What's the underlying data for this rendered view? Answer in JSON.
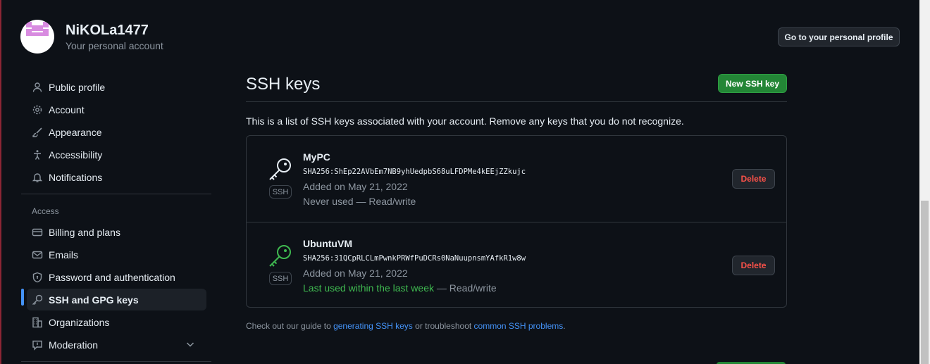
{
  "user": {
    "name": "NiKOLa1477",
    "subtitle": "Your personal account",
    "profile_button": "Go to your personal profile"
  },
  "sidebar": {
    "items": [
      {
        "label": "Public profile",
        "icon": "person-icon"
      },
      {
        "label": "Account",
        "icon": "gear-icon"
      },
      {
        "label": "Appearance",
        "icon": "paintbrush-icon"
      },
      {
        "label": "Accessibility",
        "icon": "accessibility-icon"
      },
      {
        "label": "Notifications",
        "icon": "bell-icon"
      }
    ],
    "access_label": "Access",
    "access_items": [
      {
        "label": "Billing and plans",
        "icon": "credit-card-icon"
      },
      {
        "label": "Emails",
        "icon": "mail-icon"
      },
      {
        "label": "Password and authentication",
        "icon": "shield-lock-icon"
      },
      {
        "label": "SSH and GPG keys",
        "icon": "key-icon",
        "active": true
      },
      {
        "label": "Organizations",
        "icon": "organization-icon"
      },
      {
        "label": "Moderation",
        "icon": "report-icon"
      }
    ]
  },
  "main": {
    "title": "SSH keys",
    "new_button": "New SSH key",
    "intro": "This is a list of SSH keys associated with your account. Remove any keys that you do not recognize.",
    "keys": [
      {
        "name": "MyPC",
        "fingerprint": "SHA256:ShEp22AVbEm7NB9yhUedpbS68uLFDPMe4kEEjZZkujc",
        "added": "Added on May 21, 2022",
        "usage_plain": "Never used — Read/write",
        "badge": "SSH",
        "icon_color": "#e6edf3",
        "delete": "Delete"
      },
      {
        "name": "UbuntuVM",
        "fingerprint": "SHA256:31QCpRLCLmPwnkPRWfPuDCRs0NaNuupnsmYAfkR1w8w",
        "added": "Added on May 21, 2022",
        "usage_green": "Last used within the last week",
        "usage_rest": " — Read/write",
        "badge": "SSH",
        "icon_color": "#3fb950",
        "delete": "Delete"
      }
    ],
    "footer": {
      "prefix": "Check out our guide to ",
      "link1": "generating SSH keys",
      "middle": " or troubleshoot ",
      "link2": "common SSH problems",
      "suffix": "."
    }
  },
  "colors": {
    "background": "#0d1117",
    "accent_blue": "#4493f8",
    "success_green": "#238636",
    "danger_red": "#f85149"
  }
}
